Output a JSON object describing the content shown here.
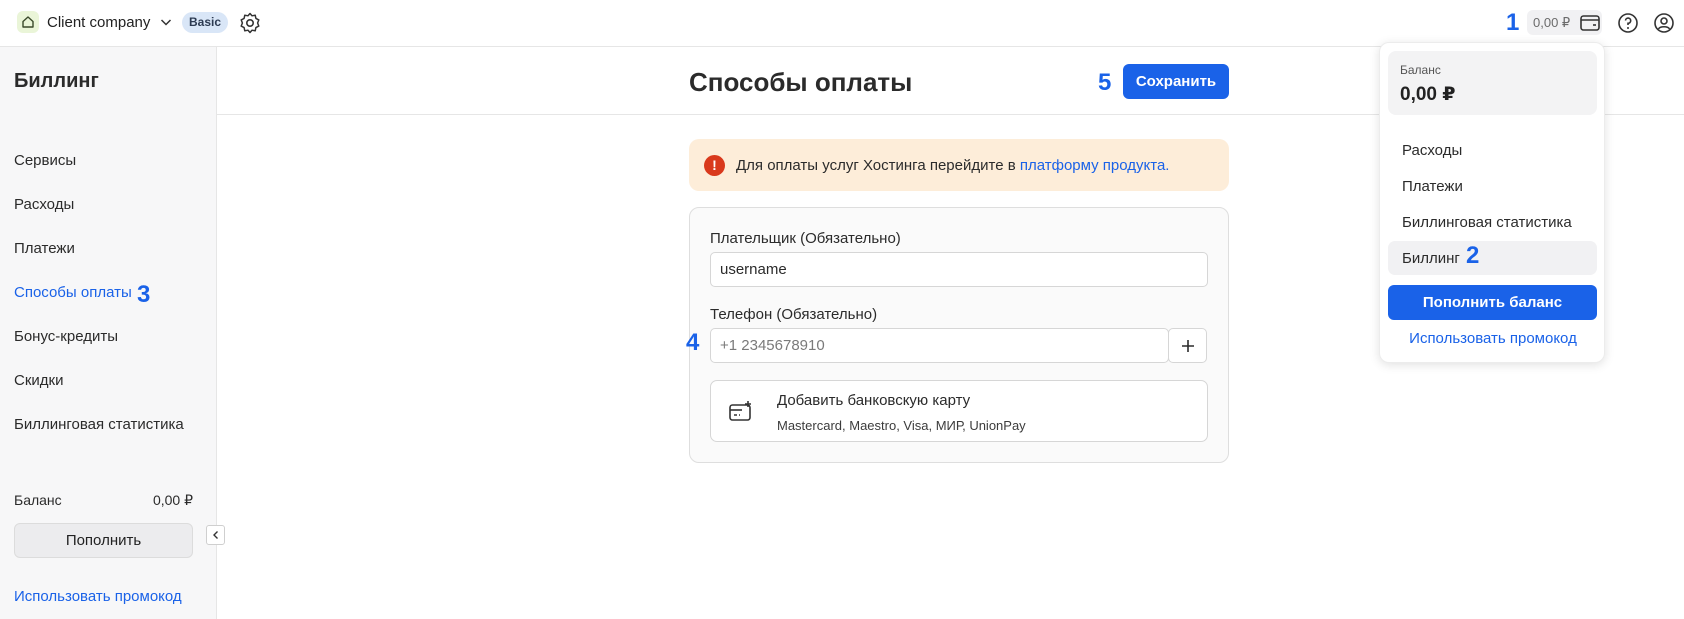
{
  "topbar": {
    "company_name": "Client company",
    "plan_badge": "Basic",
    "balance_pill": "0,00 ₽"
  },
  "markers": [
    "1",
    "2",
    "3",
    "4",
    "5"
  ],
  "sidebar": {
    "title": "Биллинг",
    "items": [
      {
        "label": "Сервисы"
      },
      {
        "label": "Расходы"
      },
      {
        "label": "Платежи"
      },
      {
        "label": "Способы оплаты"
      },
      {
        "label": "Бонус-кредиты"
      },
      {
        "label": "Скидки"
      },
      {
        "label": "Биллинговая статистика"
      }
    ],
    "active_item": "Способы оплаты",
    "balance_label": "Баланс",
    "balance_value": "0,00 ₽",
    "topup_label": "Пополнить",
    "promo_label": "Использовать промокод"
  },
  "main": {
    "title": "Способы оплаты",
    "save_label": "Сохранить",
    "alert": {
      "text": "Для оплаты услуг Хостинга перейдите в ",
      "link": "платформу продукта."
    },
    "form": {
      "payer_label": "Плательщик (Обязательно)",
      "payer_value": "username",
      "phone_label": "Телефон (Обязательно)",
      "phone_placeholder": "+1 2345678910",
      "add_card_title": "Добавить банковскую карту",
      "add_card_subtitle": "Mastercard, Maestro, Visa, МИР, UnionPay"
    }
  },
  "dropdown": {
    "balance_label": "Баланс",
    "balance_value": "0,00 ₽",
    "items": [
      {
        "label": "Расходы"
      },
      {
        "label": "Платежи"
      },
      {
        "label": "Биллинговая статистика"
      },
      {
        "label": "Биллинг"
      }
    ],
    "topup_label": "Пополнить баланс",
    "promo_label": "Использовать промокод"
  },
  "colors": {
    "accent": "#1a62e8",
    "alert_bg": "#fdedd9",
    "alert_icon": "#d9391c"
  }
}
